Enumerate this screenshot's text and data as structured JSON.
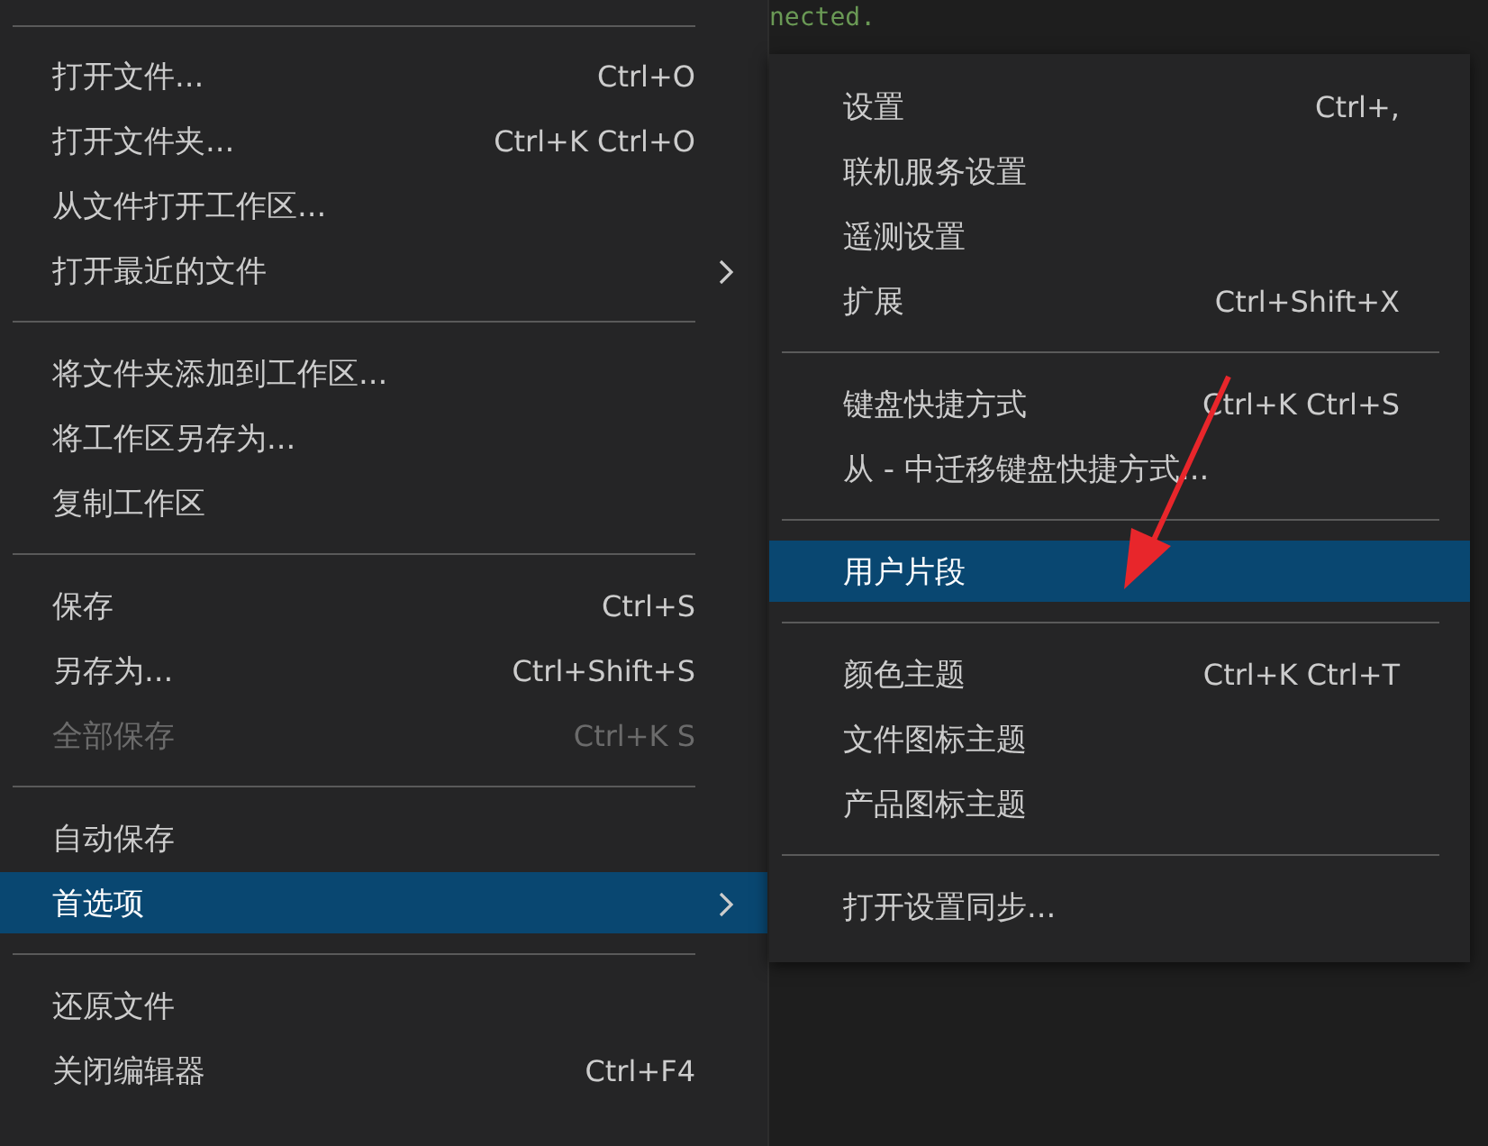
{
  "editor": {
    "code_lines": [
      "nected."
    ]
  },
  "file_menu": {
    "groups": [
      [
        {
          "label": "打开文件...",
          "shortcut": "Ctrl+O",
          "has_submenu": false,
          "disabled": false,
          "selected": false
        },
        {
          "label": "打开文件夹...",
          "shortcut": "Ctrl+K Ctrl+O",
          "has_submenu": false,
          "disabled": false,
          "selected": false
        },
        {
          "label": "从文件打开工作区...",
          "has_submenu": false,
          "disabled": false,
          "selected": false
        },
        {
          "label": "打开最近的文件",
          "has_submenu": true,
          "disabled": false,
          "selected": false
        }
      ],
      [
        {
          "label": "将文件夹添加到工作区...",
          "has_submenu": false,
          "disabled": false,
          "selected": false
        },
        {
          "label": "将工作区另存为...",
          "has_submenu": false,
          "disabled": false,
          "selected": false
        },
        {
          "label": "复制工作区",
          "has_submenu": false,
          "disabled": false,
          "selected": false
        }
      ],
      [
        {
          "label": "保存",
          "shortcut": "Ctrl+S",
          "has_submenu": false,
          "disabled": false,
          "selected": false
        },
        {
          "label": "另存为...",
          "shortcut": "Ctrl+Shift+S",
          "has_submenu": false,
          "disabled": false,
          "selected": false
        },
        {
          "label": "全部保存",
          "shortcut": "Ctrl+K S",
          "has_submenu": false,
          "disabled": true,
          "selected": false
        }
      ],
      [
        {
          "label": "自动保存",
          "has_submenu": false,
          "disabled": false,
          "selected": false
        },
        {
          "label": "首选项",
          "has_submenu": true,
          "disabled": false,
          "selected": true
        }
      ],
      [
        {
          "label": "还原文件",
          "has_submenu": false,
          "disabled": false,
          "selected": false
        },
        {
          "label": "关闭编辑器",
          "shortcut": "Ctrl+F4",
          "has_submenu": false,
          "disabled": false,
          "selected": false
        }
      ]
    ]
  },
  "preferences_submenu": {
    "groups": [
      [
        {
          "label": "设置",
          "shortcut": "Ctrl+,",
          "selected": false
        },
        {
          "label": "联机服务设置",
          "selected": false
        },
        {
          "label": "遥测设置",
          "selected": false
        },
        {
          "label": "扩展",
          "shortcut": "Ctrl+Shift+X",
          "selected": false
        }
      ],
      [
        {
          "label": "键盘快捷方式",
          "shortcut": "Ctrl+K Ctrl+S",
          "selected": false
        },
        {
          "label": "从 - 中迁移键盘快捷方式...",
          "selected": false
        }
      ],
      [
        {
          "label": "用户片段",
          "selected": true
        }
      ],
      [
        {
          "label": "颜色主题",
          "shortcut": "Ctrl+K Ctrl+T",
          "selected": false
        },
        {
          "label": "文件图标主题",
          "selected": false
        },
        {
          "label": "产品图标主题",
          "selected": false
        }
      ],
      [
        {
          "label": "打开设置同步...",
          "selected": false
        }
      ]
    ]
  }
}
